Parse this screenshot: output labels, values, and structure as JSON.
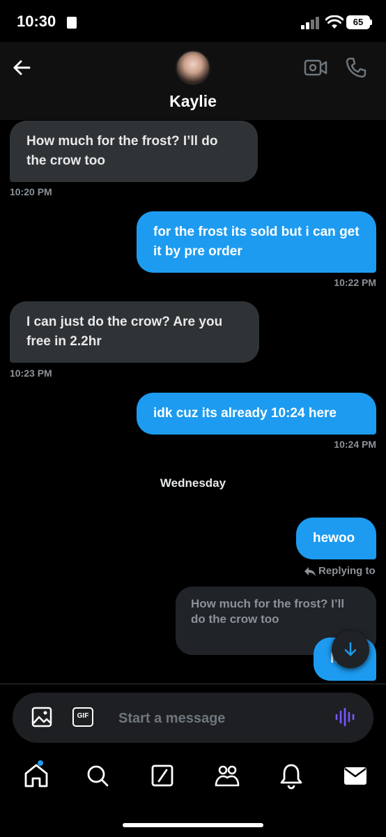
{
  "status_bar": {
    "time": "10:30",
    "battery": "65"
  },
  "header": {
    "contact_name": "Kaylie"
  },
  "messages": [
    {
      "text": "How much for the frost? I’ll do the crow too",
      "time": "10:20 PM"
    },
    {
      "text": "for the frost its sold but i can get it by pre order",
      "time": "10:22 PM"
    },
    {
      "text": "I can just do the crow? Are you free in 2.2hr",
      "time": "10:23 PM"
    },
    {
      "text": "idk cuz its already 10:24 here",
      "time": "10:24 PM"
    },
    {
      "text": "hewoo"
    }
  ],
  "day_separator": "Wednesday",
  "reply": {
    "label": "Replying to",
    "quoted_text": "How much for the frost? I’ll do the crow too",
    "partial_text": "h"
  },
  "composer": {
    "placeholder": "Start a message",
    "gif_label": "GIF"
  },
  "colors": {
    "accent": "#1d9bf0",
    "incoming_bubble": "#2f3336",
    "voice": "#7856ff"
  },
  "icons": [
    "back-arrow-icon",
    "video-camera-icon",
    "phone-icon",
    "image-icon",
    "gif-icon",
    "voice-waveform-icon",
    "arrow-down-icon",
    "home-icon",
    "search-icon",
    "grok-icon",
    "communities-icon",
    "notifications-bell-icon",
    "messages-mail-icon"
  ]
}
